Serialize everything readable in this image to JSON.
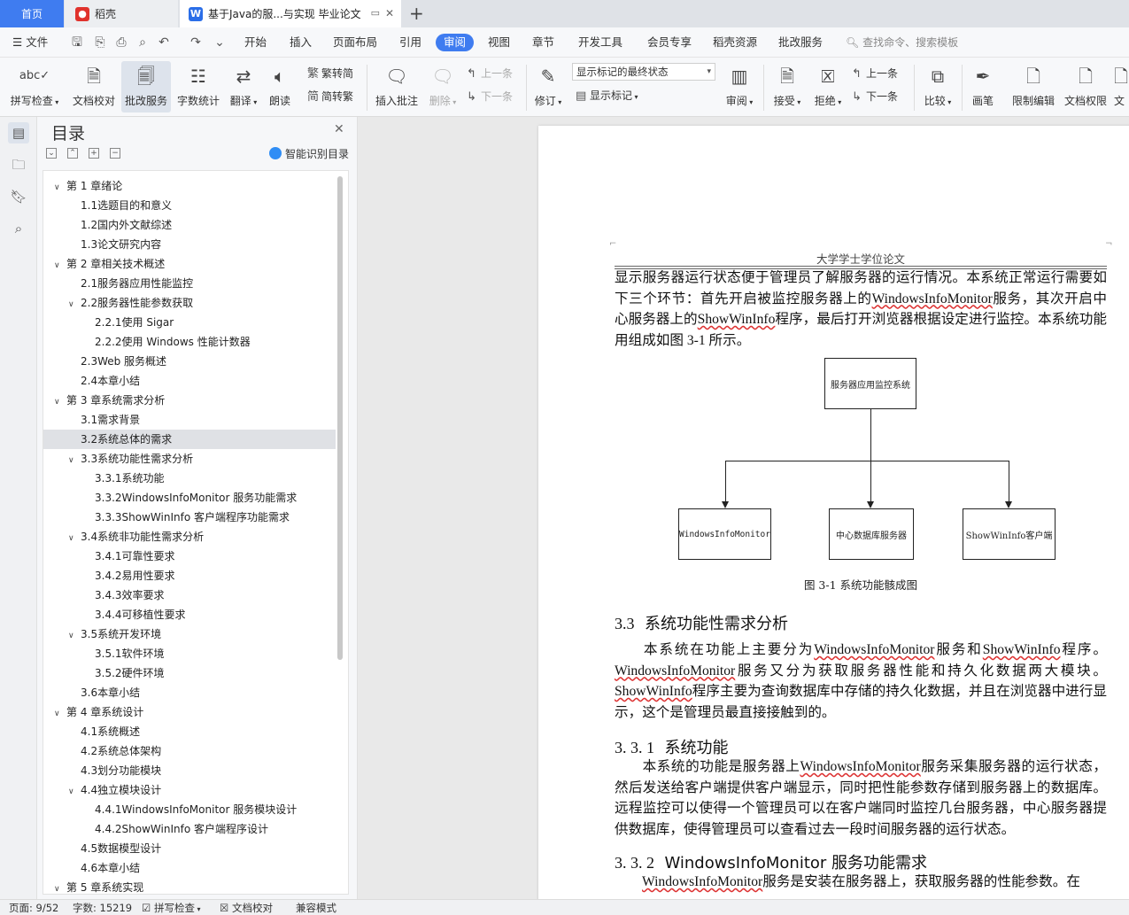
{
  "tabs": {
    "home": "首页",
    "daoke": "稻壳",
    "document": "基于Java的服...与实现 毕业论文",
    "add": "+"
  },
  "menu": {
    "file": "文件",
    "items": [
      "开始",
      "插入",
      "页面布局",
      "引用",
      "审阅",
      "视图",
      "章节",
      "开发工具",
      "会员专享",
      "稻壳资源",
      "批改服务"
    ],
    "active": "审阅",
    "search_hint": "查找命令、搜索模板"
  },
  "ribbon": {
    "spellcheck": "拼写检查",
    "doc_proof": "文档校对",
    "correction": "批改服务",
    "word_count": "字数统计",
    "translate": "翻译",
    "read_aloud": "朗读",
    "trad": "繁转简",
    "simp": "简转繁",
    "insert_comment": "插入批注",
    "delete": "删除",
    "prev_comment": "上一条",
    "next_comment": "下一条",
    "track": "修订",
    "markup_state": "显示标记的最终状态",
    "show_markup": "显示标记",
    "review": "审阅",
    "accept": "接受",
    "reject": "拒绝",
    "prev": "上一条",
    "next": "下一条",
    "compare": "比较",
    "pen": "画笔",
    "restrict": "限制编辑",
    "doc_rights": "文档权限",
    "more": "文"
  },
  "outline": {
    "title": "目录",
    "smart": "智能识别目录",
    "items": [
      {
        "text": "第 1 章绪论",
        "level": 1,
        "arrow": true
      },
      {
        "text": "1.1选题目的和意义",
        "level": 2,
        "arrow": false
      },
      {
        "text": "1.2国内外文献综述",
        "level": 2,
        "arrow": false
      },
      {
        "text": "1.3论文研究内容",
        "level": 2,
        "arrow": false
      },
      {
        "text": "第 2 章相关技术概述",
        "level": 1,
        "arrow": true
      },
      {
        "text": "2.1服务器应用性能监控",
        "level": 2,
        "arrow": false
      },
      {
        "text": "2.2服务器性能参数获取",
        "level": 2,
        "arrow": true
      },
      {
        "text": "2.2.1使用 Sigar",
        "level": 3,
        "arrow": false
      },
      {
        "text": "2.2.2使用 Windows 性能计数器",
        "level": 3,
        "arrow": false
      },
      {
        "text": "2.3Web 服务概述",
        "level": 2,
        "arrow": false
      },
      {
        "text": "2.4本章小结",
        "level": 2,
        "arrow": false
      },
      {
        "text": "第 3 章系统需求分析",
        "level": 1,
        "arrow": true
      },
      {
        "text": "3.1需求背景",
        "level": 2,
        "arrow": false
      },
      {
        "text": "3.2系统总体的需求",
        "level": 2,
        "arrow": false,
        "selected": true
      },
      {
        "text": "3.3系统功能性需求分析",
        "level": 2,
        "arrow": true
      },
      {
        "text": "3.3.1系统功能",
        "level": 3,
        "arrow": false
      },
      {
        "text": "3.3.2WindowsInfoMonitor 服务功能需求",
        "level": 3,
        "arrow": false
      },
      {
        "text": "3.3.3ShowWinInfo 客户端程序功能需求",
        "level": 3,
        "arrow": false
      },
      {
        "text": "3.4系统非功能性需求分析",
        "level": 2,
        "arrow": true
      },
      {
        "text": "3.4.1可靠性要求",
        "level": 3,
        "arrow": false
      },
      {
        "text": "3.4.2易用性要求",
        "level": 3,
        "arrow": false
      },
      {
        "text": "3.4.3效率要求",
        "level": 3,
        "arrow": false
      },
      {
        "text": "3.4.4可移植性要求",
        "level": 3,
        "arrow": false
      },
      {
        "text": "3.5系统开发环境",
        "level": 2,
        "arrow": true
      },
      {
        "text": "3.5.1软件环境",
        "level": 3,
        "arrow": false
      },
      {
        "text": "3.5.2硬件环境",
        "level": 3,
        "arrow": false
      },
      {
        "text": "3.6本章小结",
        "level": 2,
        "arrow": false
      },
      {
        "text": "第 4 章系统设计",
        "level": 1,
        "arrow": true
      },
      {
        "text": "4.1系统概述",
        "level": 2,
        "arrow": false
      },
      {
        "text": "4.2系统总体架构",
        "level": 2,
        "arrow": false
      },
      {
        "text": "4.3划分功能模块",
        "level": 2,
        "arrow": false
      },
      {
        "text": "4.4独立模块设计",
        "level": 2,
        "arrow": true
      },
      {
        "text": "4.4.1WindowsInfoMonitor 服务模块设计",
        "level": 3,
        "arrow": false
      },
      {
        "text": "4.4.2ShowWinInfo 客户端程序设计",
        "level": 3,
        "arrow": false
      },
      {
        "text": "4.5数据模型设计",
        "level": 2,
        "arrow": false
      },
      {
        "text": "4.6本章小结",
        "level": 2,
        "arrow": false
      },
      {
        "text": "第 5 章系统实现",
        "level": 1,
        "arrow": true
      }
    ]
  },
  "doc": {
    "header": "大学学士学位论文",
    "p1": "显示服务器运行状态便于管理员了解服务器的运行情况。本系统正常运行需要如下三个环节：首先开启被监控服务器上的",
    "p1_w1": "WindowsInfoMonitor",
    "p1_b": "服务，其次开启中心服务器上的",
    "p1_w2": "ShowWinInfo",
    "p1_c": "程序，最后打开浏览器根据设定进行监控。本系统功能用组成如图 3-1 所示。",
    "diagram": {
      "root": "服务器应用监控系统",
      "child1": "WindowsInfoMonitor",
      "child2": "中心数据库服务器",
      "child3": "ShowWinInfo客户端"
    },
    "caption": "图 3-1 系统功能骸成图",
    "h33_num": "3.3",
    "h33": "系统功能性需求分析",
    "p2_a": "本系统在功能上主要分为",
    "p2_w1": "WindowsInfoMonitor",
    "p2_b": "服务和",
    "p2_w2": "ShowWinInfo",
    "p2_c": "程序。",
    "p2_w3": "WindowsInfoMonitor",
    "p2_d": "服务又分为获取服务器性能和持久化数据两大模块。",
    "p2_w4": "ShowWinInfo",
    "p2_e": "程序主要为查询数据库中存储的持久化数据，并且在浏览器中进行显示，这个是管理员最直接接触到的。",
    "h331_num": "3. 3. 1",
    "h331": "系统功能",
    "p3_a": "本系统的功能是服务器上",
    "p3_w1": "WindowsInfoMonitor",
    "p3_b": "服务采集服务器的运行状态，然后发送给客户端提供客户端显示，同时把性能参数存储到服务器上的数据库。远程监控可以使得一个管理员可以在客户端同时监控几台服务器，中心服务器提供数据库，使得管理员可以查看过去一段时间服务器的运行状态。",
    "h332_num": "3. 3. 2",
    "h332": "WindowsInfoMonitor 服务功能需求",
    "p4_w1": "WindowsInfoMonitor",
    "p4_a": "服务是安装在服务器上，获取服务器的性能参数。在"
  },
  "status": {
    "page": "页面: 9/52",
    "words": "字数: 15219",
    "spell": "拼写检查",
    "proof": "文档校对",
    "compat": "兼容模式"
  }
}
